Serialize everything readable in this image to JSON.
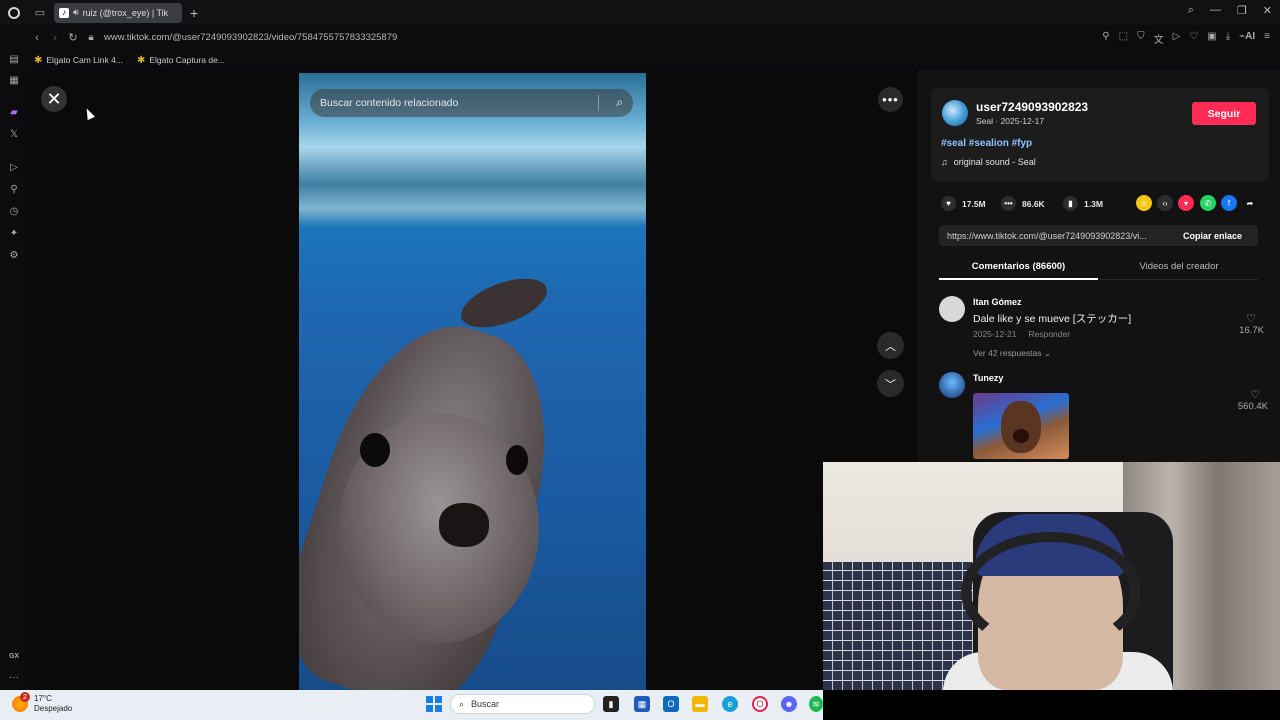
{
  "browser": {
    "tab_title": "ruiz (@trox_eye) | Tik",
    "tab_favicon": "tiktok-icon",
    "url": "www.tiktok.com/@user7249093902823/video/7584755757833325879",
    "bookmarks": [
      "Elgato Cam Link 4...",
      "Elgato Captura de..."
    ],
    "ai_label": "AI",
    "sidebar_bottom_label": "GX"
  },
  "video": {
    "search_placeholder": "Buscar contenido relacionado"
  },
  "creator": {
    "username": "user7249093902823",
    "subline": "Seal · 2025-12-17",
    "follow_label": "Seguir",
    "hashtags": "#seal #sealion #fyp",
    "sound": "original sound - Seal"
  },
  "stats": {
    "likes": "17.5M",
    "comments": "86.6K",
    "saves": "1.3M"
  },
  "share": {
    "link": "https://www.tiktok.com/@user7249093902823/vi...",
    "copy_label": "Copiar enlace"
  },
  "tabs": {
    "comments": "Comentarios (86600)",
    "videos": "Videos del creador"
  },
  "comments": [
    {
      "name": "Itan Gómez",
      "text": "Dale like y se mueve [ステッカー]",
      "date": "2025-12-21",
      "reply_label": "Responder",
      "replies": "Ver 42 respuestas",
      "likes": "16.7K"
    },
    {
      "name": "Tunezy",
      "likes": "560.4K"
    }
  ],
  "taskbar": {
    "temperature": "17°C",
    "weather": "Despejado",
    "notification_count": "2",
    "search_label": "Buscar"
  },
  "colors": {
    "accent_follow": "#fe2c55",
    "hashtag": "#8fc4ff"
  }
}
